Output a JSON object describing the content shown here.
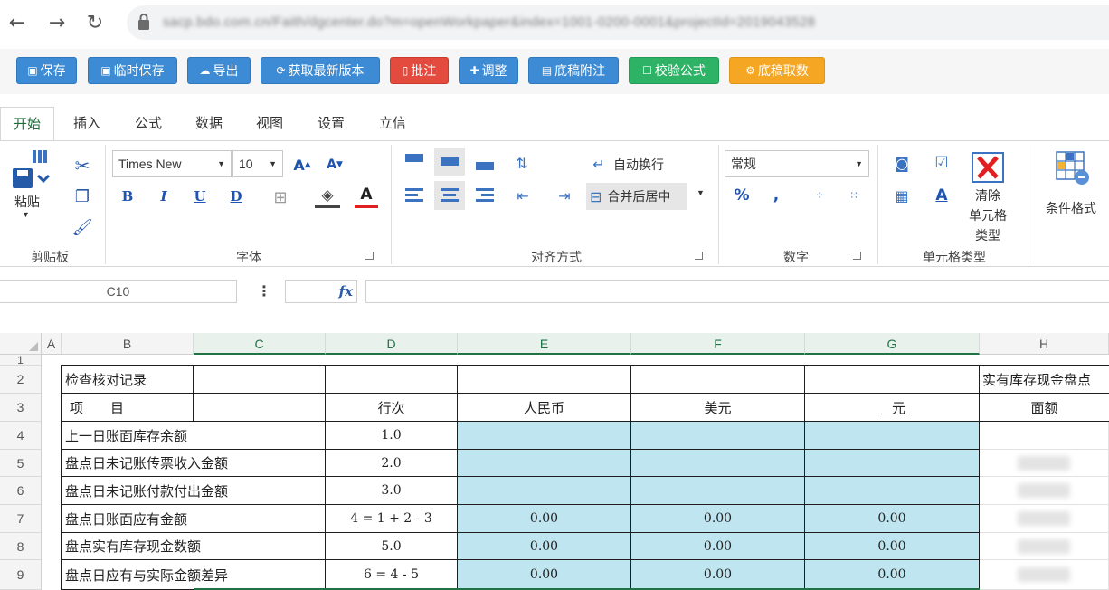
{
  "browser": {
    "url": "sacp.bdo.com.cn/Faith/dgcenter.do?m=openWorkpaper&index=1001-0200-0001&projectId=2019043528"
  },
  "actions": [
    {
      "label": "保存",
      "icon": "save-icon",
      "color": "blue"
    },
    {
      "label": "临时保存",
      "icon": "temp-save-icon",
      "color": "blue"
    },
    {
      "label": "导出",
      "icon": "cloud-export-icon",
      "color": "blue"
    },
    {
      "label": "获取最新版本",
      "icon": "refresh-icon",
      "color": "blue"
    },
    {
      "label": "批注",
      "icon": "bookmark-icon",
      "color": "red"
    },
    {
      "label": "调整",
      "icon": "plus-icon",
      "color": "blue"
    },
    {
      "label": "底稿附注",
      "icon": "document-icon",
      "color": "blue"
    },
    {
      "label": "校验公式",
      "icon": "check-square-icon",
      "color": "green"
    },
    {
      "label": "底稿取数",
      "icon": "fetch-data-icon",
      "color": "orange"
    }
  ],
  "ribbon": {
    "tabs": [
      "开始",
      "插入",
      "公式",
      "数据",
      "视图",
      "设置",
      "立信"
    ],
    "groups": {
      "clipboard": "剪贴板",
      "font": "字体",
      "alignment": "对齐方式",
      "number": "数字",
      "cell_type": "单元格类型"
    },
    "paste_label": "粘贴",
    "font_name": "Times New",
    "font_size": "10",
    "wrap_text": "自动换行",
    "merge_center": "合并后居中",
    "number_format": "常规",
    "clear_cell_type": "清除\n单元格\n类型",
    "clear_line1": "清除",
    "clear_line2": "单元格",
    "clear_line3": "类型",
    "conditional_format": "条件格式"
  },
  "formula_bar": {
    "name_box": "C10",
    "more": "⋮",
    "fx": "fx"
  },
  "sheet": {
    "columns": [
      "A",
      "B",
      "C",
      "D",
      "E",
      "F",
      "G",
      "H"
    ],
    "active_column": "C",
    "rows": [
      "1",
      "2",
      "3",
      "4",
      "5",
      "6",
      "7",
      "8",
      "9"
    ],
    "r2": {
      "b": "检查核对记录",
      "h": "实有库存现金盘点"
    },
    "r3": {
      "b": "项　　目",
      "d": "行次",
      "e": "人民币",
      "f": "美元",
      "g": "　元",
      "h": "面额"
    },
    "items": [
      {
        "label": "上一日账面库存余额",
        "line": "1.0",
        "e": "",
        "f": "",
        "g": ""
      },
      {
        "label": "盘点日未记账传票收入金额",
        "line": "2.0",
        "e": "",
        "f": "",
        "g": ""
      },
      {
        "label": "盘点日未记账付款付出金额",
        "line": "3.0",
        "e": "",
        "f": "",
        "g": ""
      },
      {
        "label": "盘点日账面应有金额",
        "line": "4 = 1 + 2 - 3",
        "e": "0.00",
        "f": "0.00",
        "g": "0.00"
      },
      {
        "label": "盘点实有库存现金数额",
        "line": "5.0",
        "e": "0.00",
        "f": "0.00",
        "g": "0.00"
      },
      {
        "label": "盘点日应有与实际金额差异",
        "line": "6 = 4 - 5",
        "e": "0.00",
        "f": "0.00",
        "g": "0.00"
      }
    ]
  }
}
